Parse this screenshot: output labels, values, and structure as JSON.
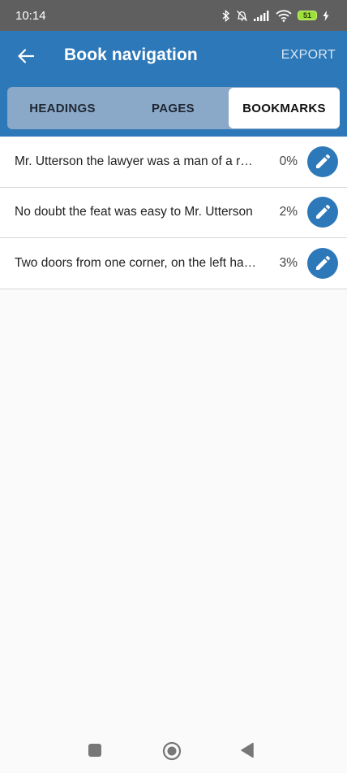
{
  "status_bar": {
    "time": "10:14",
    "battery_level": "51"
  },
  "app_bar": {
    "title": "Book navigation",
    "export_label": "EXPORT"
  },
  "tabs": [
    {
      "label": "HEADINGS",
      "selected": false
    },
    {
      "label": "PAGES",
      "selected": false
    },
    {
      "label": "BOOKMARKS",
      "selected": true
    }
  ],
  "bookmarks": [
    {
      "text": "Mr. Utterson the lawyer was a man of a rugged countenance",
      "percent": "0%"
    },
    {
      "text": "No doubt the feat was easy to Mr. Utterson",
      "percent": "2%"
    },
    {
      "text": "Two doors from one corner, on the left hand going east",
      "percent": "3%"
    }
  ],
  "colors": {
    "primary": "#2d78b8",
    "status_bar": "#5f5f5f",
    "tab_bar": "#8aa8c8"
  },
  "icons": {
    "back": "arrow-left-icon",
    "edit": "pencil-icon",
    "nav_recents": "square-icon",
    "nav_home": "circle-icon",
    "nav_back": "triangle-left-icon"
  }
}
